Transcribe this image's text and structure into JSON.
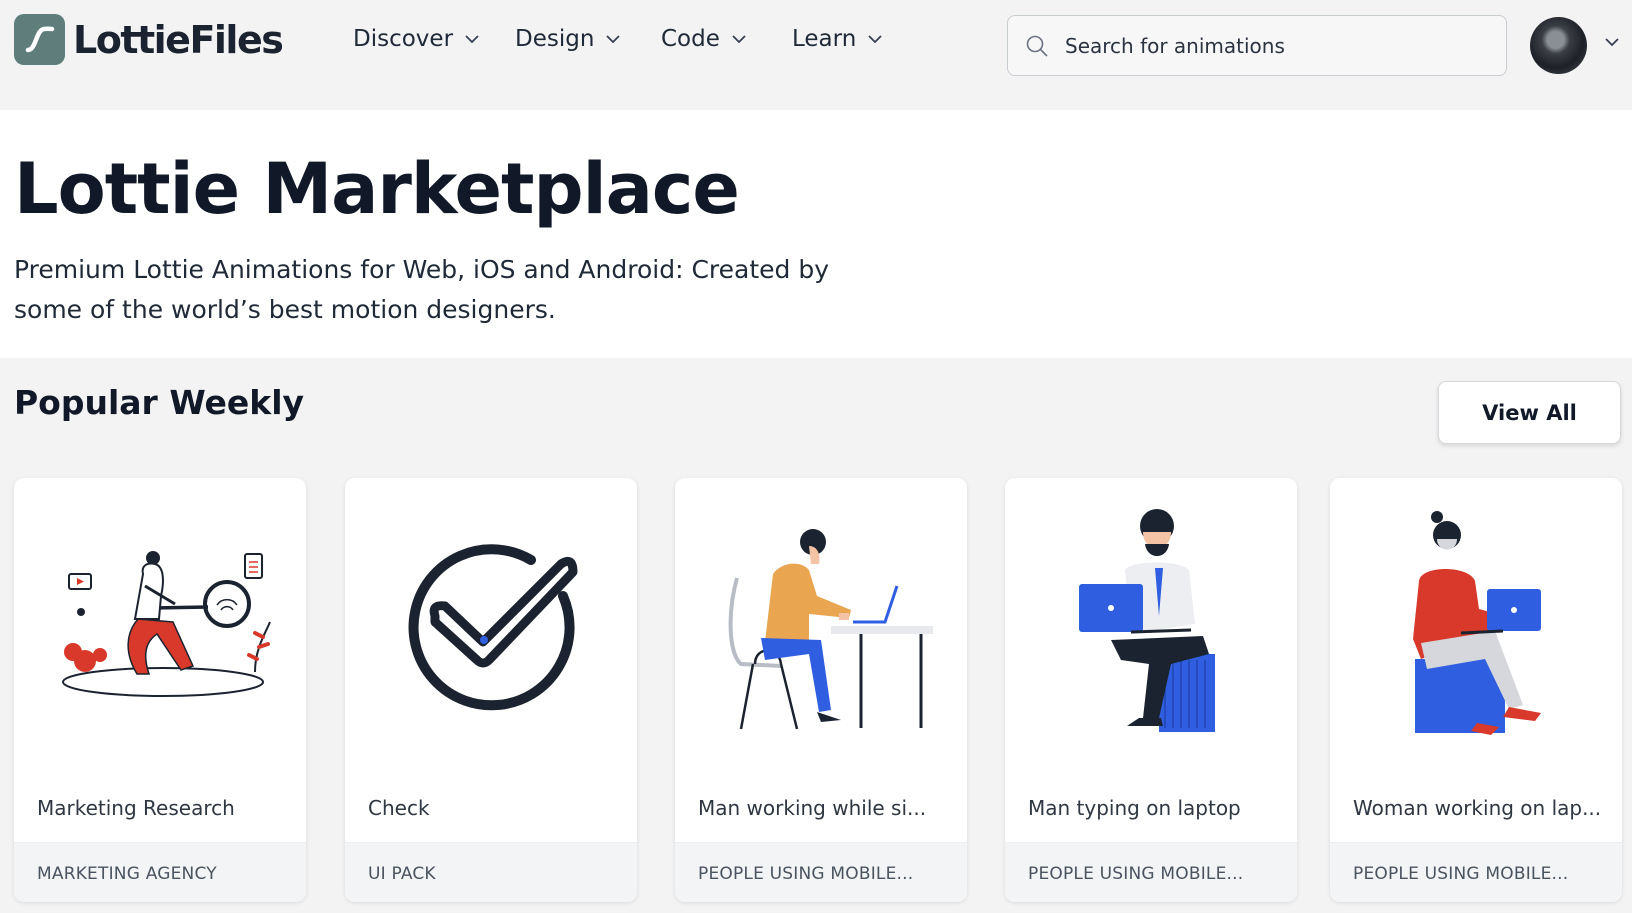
{
  "brand": {
    "name": "LottieFiles",
    "color": "#5f7d7b"
  },
  "nav": {
    "items": [
      {
        "label": "Discover"
      },
      {
        "label": "Design"
      },
      {
        "label": "Code"
      },
      {
        "label": "Learn"
      }
    ]
  },
  "search": {
    "placeholder": "Search for animations",
    "value": ""
  },
  "hero": {
    "title": "Lottie Marketplace",
    "subtitle": "Premium Lottie Animations for Web, iOS and Android: Created by some of the world’s best motion designers."
  },
  "popular": {
    "title": "Popular Weekly",
    "view_all_label": "View All",
    "cards": [
      {
        "name": "Marketing Research",
        "tag": "MARKETING AGENCY",
        "illustration": "marketing-research-illustration"
      },
      {
        "name": "Check",
        "tag": "UI PACK",
        "illustration": "check-illustration"
      },
      {
        "name": "Man working while si...",
        "tag": "PEOPLE USING MOBILE...",
        "illustration": "man-desk-illustration"
      },
      {
        "name": "Man typing on laptop",
        "tag": "PEOPLE USING MOBILE...",
        "illustration": "man-laptop-illustration"
      },
      {
        "name": "Woman working on lap...",
        "tag": "PEOPLE USING MOBILE...",
        "illustration": "woman-laptop-illustration"
      }
    ]
  },
  "colors": {
    "accent_blue": "#2f5fe0",
    "accent_red": "#d8392b",
    "accent_orange": "#e9a54f",
    "dark": "#1c2330"
  }
}
